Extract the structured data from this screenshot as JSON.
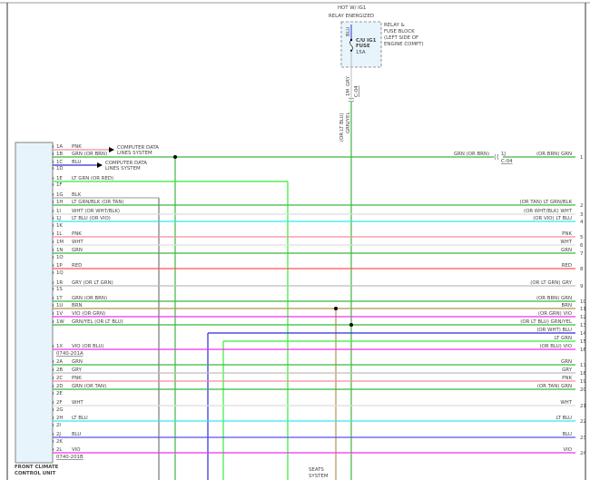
{
  "module": {
    "name_line1": "FRONT CLIMATE",
    "name_line2": "CONTROL UNIT",
    "connector_a": "0740-201A",
    "connector_b": "0740-201B"
  },
  "power": {
    "hot_label": "HOT W/ IG1",
    "relay_label": "RELAY ENERGIZED",
    "block_lines": [
      "RELAY &",
      "FUSE BLOCK",
      "(LEFT SIDE OF",
      "ENGINE COMPT)"
    ],
    "fuse_lines": [
      "C/U IG1",
      "FUSE",
      "15A"
    ],
    "wire_in": "BLU",
    "wire_out": "GRY",
    "pin": "1M",
    "connector": "C-04",
    "down_wire_1": "(OR LT BLU)",
    "down_wire_2": "GRN/YEL"
  },
  "connector_c04": {
    "pin": "1J",
    "name": "C-04",
    "left_label": "GRN (OR BRN)"
  },
  "arrows": [
    {
      "pin": "1A",
      "text1": "COMPUTER DATA",
      "text2": "LINES SYSTEM"
    },
    {
      "pin": "1C",
      "text1": "COMPUTER DATA",
      "text2": "LINES SYSTEM"
    }
  ],
  "seats_label": [
    "SEATS",
    "SYSTEM"
  ],
  "colors": {
    "PNK": "#f48ca0",
    "GRN": "#3cb83c",
    "BLU": "#2b2bdc",
    "LTGRN": "#33ee33",
    "GRY": "#bdbdbd",
    "LTBLU": "#33e6f2",
    "WHT": "#dddddd",
    "RED": "#ff5555",
    "BRN": "#b09458",
    "VIO": "#ee33ee",
    "BLUE2": "#5555ee",
    "BLK": "#777777"
  },
  "pins": [
    {
      "pin": "1A",
      "label": "PNK",
      "color": "PNK"
    },
    {
      "pin": "1B",
      "label": "GRN (OR BRN)",
      "color": "GRN",
      "right": "(OR BRN) GRN",
      "num": "1"
    },
    {
      "pin": "1C",
      "label": "BLU",
      "color": "BLU"
    },
    {
      "pin": "1D",
      "label": ""
    },
    {
      "pin": "1E",
      "label": "LT GRN (OR RED)",
      "color": "LTGRN"
    },
    {
      "pin": "1F",
      "label": ""
    },
    {
      "pin": "1G",
      "label": "BLK",
      "color": "BLK"
    },
    {
      "pin": "1H",
      "label": "LT GRN/BLK (OR TAN)",
      "color": "GRN",
      "right": "(OR TAN) LT GRN/BLK",
      "num": "2"
    },
    {
      "pin": "1I",
      "label": "WHT (OR WHT/BLK)",
      "color": "WHT",
      "right": "(OR WHT/BLK) WHT",
      "num": "3"
    },
    {
      "pin": "1J",
      "label": "LT BLU (OR VIO)",
      "color": "LTBLU",
      "right": "(OR VIO) LT BLU",
      "num": "4"
    },
    {
      "pin": "1K",
      "label": ""
    },
    {
      "pin": "1L",
      "label": "PNK",
      "color": "PNK",
      "right": "PNK",
      "num": "5"
    },
    {
      "pin": "1M",
      "label": "WHT",
      "color": "WHT",
      "right": "WHT",
      "num": "6"
    },
    {
      "pin": "1N",
      "label": "GRN",
      "color": "GRN",
      "right": "GRN",
      "num": "7"
    },
    {
      "pin": "1O",
      "label": ""
    },
    {
      "pin": "1P",
      "label": "RED",
      "color": "RED",
      "right": "RED",
      "num": "8"
    },
    {
      "pin": "1Q",
      "label": ""
    },
    {
      "pin": "1R",
      "label": "GRY (OR LT GRN)",
      "color": "GRY",
      "right": "(OR LT GRN) GRY",
      "num": "9"
    },
    {
      "pin": "1S",
      "label": ""
    },
    {
      "pin": "1T",
      "label": "GRN (OR BRN)",
      "color": "GRN",
      "right": "(OR BRN) GRN",
      "num": "10"
    },
    {
      "pin": "1U",
      "label": "BRN",
      "color": "BRN",
      "right": "BRN",
      "num": "11"
    },
    {
      "pin": "1V",
      "label": "VIO (OR GRN)",
      "color": "VIO",
      "right": "(OR GRN) VIO",
      "num": "12"
    },
    {
      "pin": "1W",
      "label": "GRN/YEL (OR LT BLU)",
      "color": "GRN",
      "right": "(OR LT BLU) GRN/YEL",
      "num": "13"
    },
    {
      "pin": "",
      "label": "",
      "color": "BLU",
      "right": "(OR WHT) BLU",
      "num": "14"
    },
    {
      "pin": "",
      "label": "",
      "color": "LTGRN",
      "right": "LT GRN",
      "num": "15"
    },
    {
      "pin": "1X",
      "label": "VIO (OR BLU)",
      "color": "VIO",
      "right": "(OR BLU) VIO",
      "num": "16"
    },
    {
      "pin": "2A",
      "label": "GRN",
      "color": "GRN",
      "right": "GRN",
      "num": "17"
    },
    {
      "pin": "2B",
      "label": "GRY",
      "color": "GRY",
      "right": "GRY",
      "num": "18"
    },
    {
      "pin": "2C",
      "label": "PNK",
      "color": "PNK",
      "right": "PNK",
      "num": "19"
    },
    {
      "pin": "2D",
      "label": "GRN (OR TAN)",
      "color": "GRN",
      "right": "(OR TAN) GRN",
      "num": "20"
    },
    {
      "pin": "2E",
      "label": ""
    },
    {
      "pin": "2F",
      "label": "WHT",
      "color": "WHT",
      "right": "WHT",
      "num": "21"
    },
    {
      "pin": "2G",
      "label": ""
    },
    {
      "pin": "2H",
      "label": "LT BLU",
      "color": "LTBLU",
      "right": "LT BLU",
      "num": "22"
    },
    {
      "pin": "2I",
      "label": ""
    },
    {
      "pin": "2J",
      "label": "BLU",
      "color": "BLUE2",
      "right": "BLU",
      "num": "23"
    },
    {
      "pin": "2K",
      "label": ""
    },
    {
      "pin": "2L",
      "label": "VIO",
      "color": "VIO",
      "right": "VIO",
      "num": "24"
    }
  ]
}
